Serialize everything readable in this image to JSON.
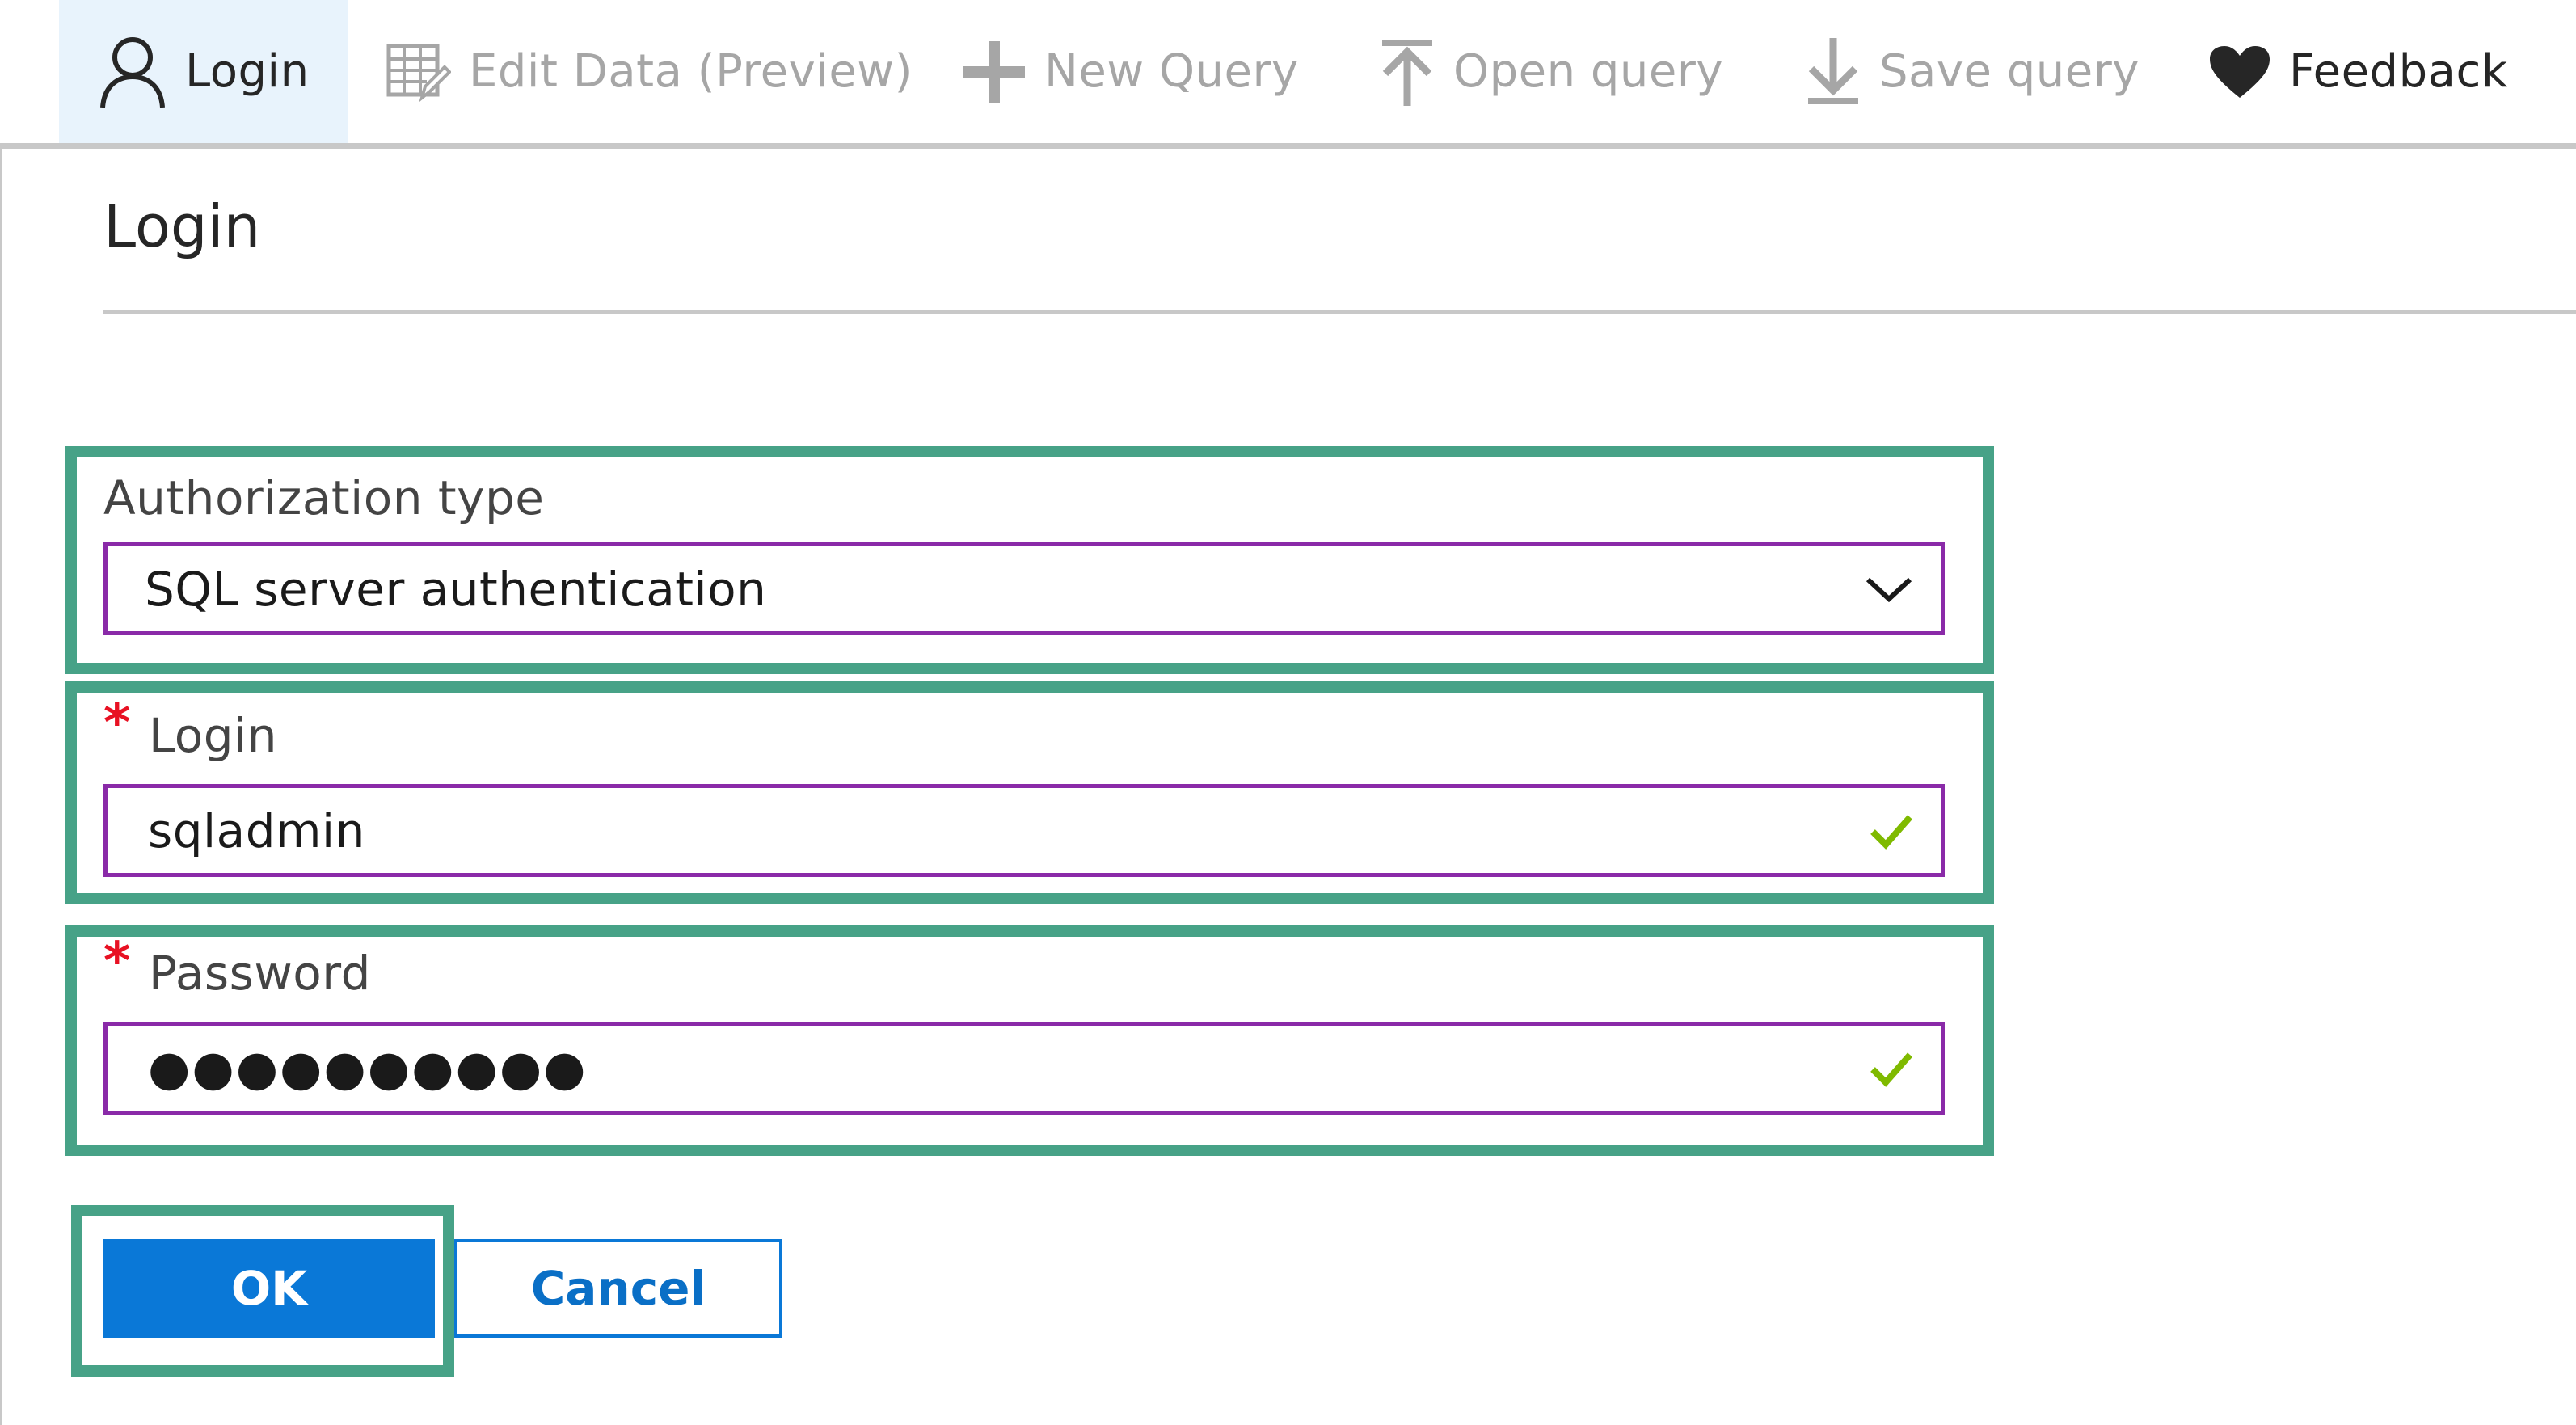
{
  "toolbar": {
    "items": [
      {
        "label": "Login",
        "icon": "user-icon",
        "active": true
      },
      {
        "label": "Edit Data (Preview)",
        "icon": "edit-table-icon",
        "disabled": true
      },
      {
        "label": "New Query",
        "icon": "plus-icon",
        "disabled": true
      },
      {
        "label": "Open query",
        "icon": "upload-arrow-icon",
        "disabled": true
      },
      {
        "label": "Save query",
        "icon": "download-arrow-icon",
        "disabled": true
      },
      {
        "label": "Feedback",
        "icon": "heart-icon"
      }
    ]
  },
  "page": {
    "title": "Login"
  },
  "form": {
    "auth_type": {
      "label": "Authorization type",
      "value": "SQL server authentication",
      "icon": "chevron-down-icon"
    },
    "login": {
      "required_mark": "*",
      "label": "Login",
      "value": "sqladmin",
      "status_icon": "checkmark-icon"
    },
    "password": {
      "required_mark": "*",
      "label": "Password",
      "value": "●●●●●●●●●●",
      "status_icon": "checkmark-icon"
    }
  },
  "buttons": {
    "ok": "OK",
    "cancel": "Cancel"
  },
  "colors": {
    "highlight": "#47a287",
    "input_border": "#8a2aa8",
    "primary": "#0a78d7",
    "required": "#e81123",
    "valid": "#7fba00"
  }
}
